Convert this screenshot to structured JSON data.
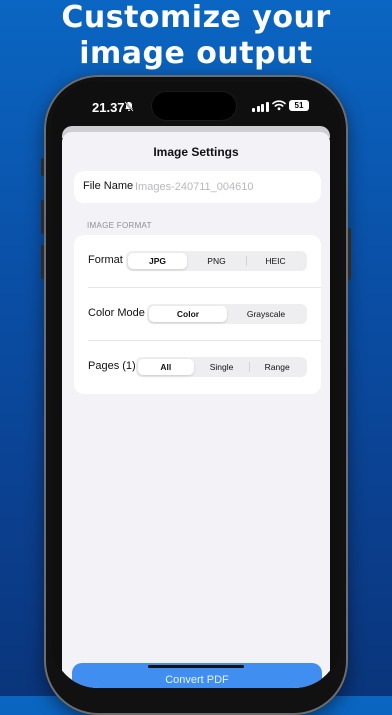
{
  "headline": {
    "line1": "Customize your",
    "line2": "image output"
  },
  "status_bar": {
    "time": "21.37",
    "bell_icon": "bell-slash-icon",
    "signal_icon": "cellular-signal-icon",
    "wifi_icon": "wifi-icon",
    "battery": "51"
  },
  "sheet": {
    "title": "Image Settings",
    "file_name": {
      "label": "File Name",
      "placeholder": "Images-240711_004610",
      "value": ""
    },
    "section_header": "IMAGE FORMAT",
    "format": {
      "label": "Format",
      "options": [
        "JPG",
        "PNG",
        "HEIC"
      ],
      "selected": "JPG"
    },
    "color_mode": {
      "label": "Color Mode",
      "options": [
        "Color",
        "Grayscale"
      ],
      "selected": "Color"
    },
    "pages": {
      "label": "Pages (1)",
      "options": [
        "All",
        "Single",
        "Range"
      ],
      "selected": "All"
    },
    "convert_button": "Convert PDF"
  },
  "colors": {
    "background_top": "#0a66c2",
    "background_bottom": "#0a357b",
    "accent": "#3f8ef0",
    "sheet_background": "#f2f2f7"
  }
}
